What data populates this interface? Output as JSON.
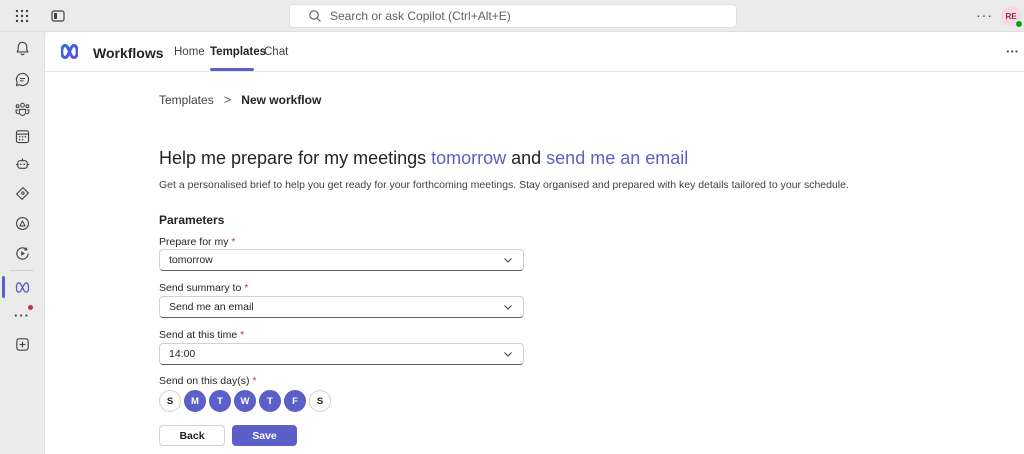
{
  "topbar": {
    "search_placeholder": "Search or ask Copilot (Ctrl+Alt+E)",
    "more_label": "···",
    "avatar_initials": "RE"
  },
  "rail": {
    "icons": [
      "bell-icon",
      "chat-icon",
      "teams-icon",
      "calendar-icon",
      "copilot-icon",
      "apps-icon",
      "onedrive-icon",
      "playback-icon",
      "workflows-icon",
      "more-icon",
      "add-icon"
    ],
    "more_label": "···",
    "accent": "#5b5fc7",
    "notification_color": "#c4314b"
  },
  "app": {
    "name": "Workflows",
    "tabs": [
      {
        "label": "Home"
      },
      {
        "label": "Templates",
        "active": true
      },
      {
        "label": "Chat"
      }
    ],
    "more_label": "···"
  },
  "breadcrumb": {
    "parent": "Templates",
    "separator": ">",
    "current": "New workflow"
  },
  "heading": {
    "part1": "Help me prepare for my meetings ",
    "highlight1": "tomorrow",
    "part2": " and ",
    "highlight2": "send me an email"
  },
  "description": "Get a personalised brief to help you get ready for your forthcoming meetings. Stay organised and prepared with key details tailored to your schedule.",
  "parameters": {
    "heading": "Parameters",
    "required_mark": "*",
    "fields": [
      {
        "label": "Prepare for my ",
        "value": "tomorrow"
      },
      {
        "label": "Send summary to  ",
        "value": "Send me an email"
      },
      {
        "label": "Send at this time ",
        "value": "14:00"
      }
    ],
    "days_label": "Send on this day(s) ",
    "days": [
      {
        "label": "S",
        "selected": false
      },
      {
        "label": "M",
        "selected": true
      },
      {
        "label": "T",
        "selected": true
      },
      {
        "label": "W",
        "selected": true
      },
      {
        "label": "T",
        "selected": true
      },
      {
        "label": "F",
        "selected": true
      },
      {
        "label": "S",
        "selected": false
      }
    ]
  },
  "buttons": {
    "back": "Back",
    "save": "Save"
  }
}
